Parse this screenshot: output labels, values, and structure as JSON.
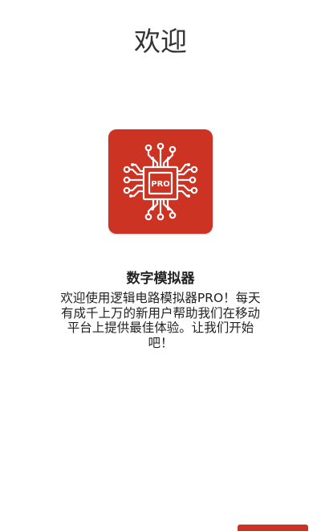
{
  "header": {
    "title": "欢迎"
  },
  "logo": {
    "chip_label": "PRO",
    "icon": "circuit-chip-icon",
    "background_color": "#cc3322"
  },
  "main": {
    "app_name": "数字模拟器",
    "description": "欢迎使用逻辑电路模拟器PRO！每天有成千上万的新用户帮助我们在移动平台上提供最佳体验。让我们开始吧！"
  },
  "footer": {
    "next_button_color": "#cc3322"
  }
}
